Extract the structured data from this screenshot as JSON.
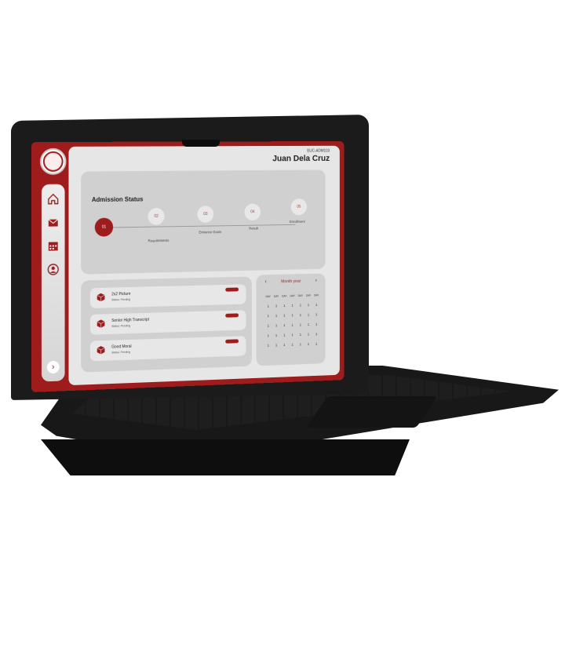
{
  "sidebar": {
    "logo": "university-seal-logo",
    "nav": [
      "home-icon",
      "mail-icon",
      "calendar-icon",
      "profile-icon"
    ],
    "collapse": "›"
  },
  "header": {
    "student_id": "EUC-ADM103",
    "student_name": "Juan Dela Cruz"
  },
  "admission": {
    "title": "Admission Status",
    "steps": [
      {
        "num": "01",
        "label": ""
      },
      {
        "num": "02",
        "label": "Requirements"
      },
      {
        "num": "03",
        "label": "Entrance Exam"
      },
      {
        "num": "04",
        "label": "Result"
      },
      {
        "num": "05",
        "label": "Enrollment"
      }
    ],
    "active_step": 1
  },
  "requirements": [
    {
      "name": "2x2 Picture",
      "status": "Status: Pending"
    },
    {
      "name": "Senior High Transcript",
      "status": "Status: Pending"
    },
    {
      "name": "Good Moral",
      "status": "Status: Pending"
    }
  ],
  "calendar": {
    "title": "Month year",
    "prev": "‹",
    "next": "›",
    "day_names": [
      "DAY",
      "DAY",
      "DAY",
      "DAY",
      "DAY",
      "DAY",
      "DAY"
    ],
    "weeks": [
      [
        "1",
        "1",
        "1",
        "1",
        "1",
        "1",
        "1"
      ],
      [
        "1",
        "1",
        "1",
        "1",
        "1",
        "1",
        "1"
      ],
      [
        "1",
        "1",
        "1",
        "1",
        "1",
        "1",
        "1"
      ],
      [
        "1",
        "1",
        "1",
        "1",
        "1",
        "1",
        "1"
      ],
      [
        "1",
        "1",
        "1",
        "1",
        "1",
        "1",
        "1"
      ]
    ]
  },
  "colors": {
    "accent": "#9f1c1c",
    "panel": "#e6e6e6",
    "card": "#d0d0d0"
  }
}
